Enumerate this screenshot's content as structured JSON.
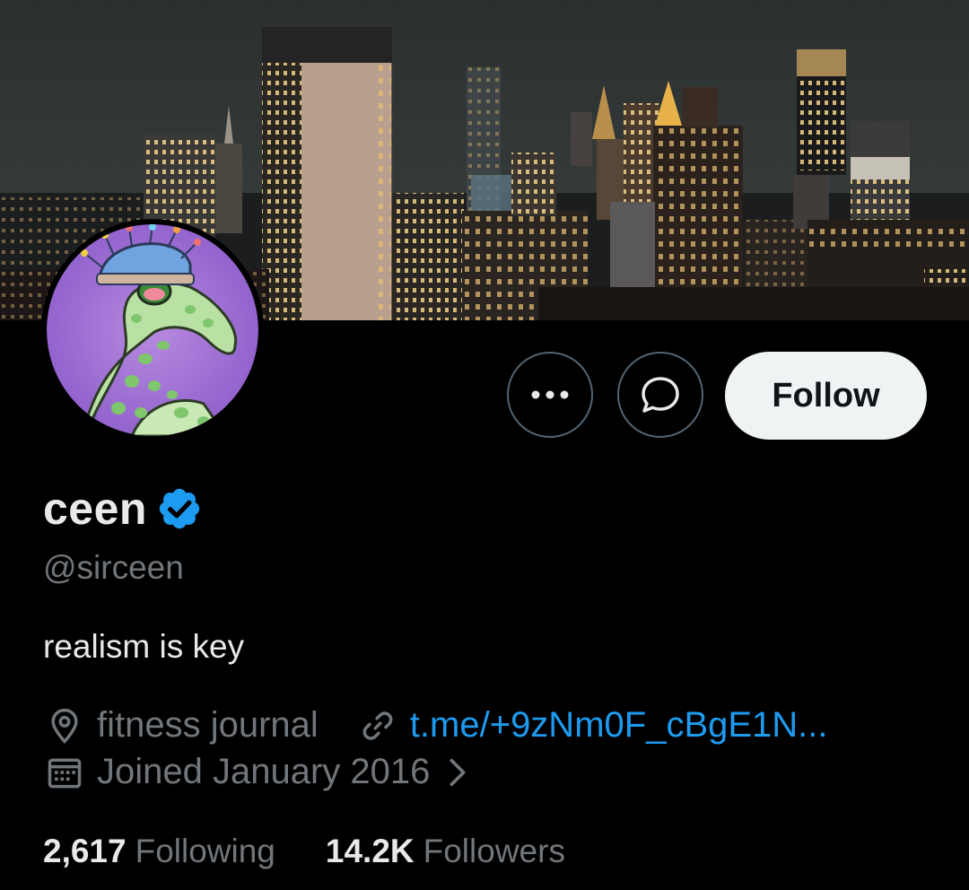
{
  "profile": {
    "display_name": "ceen",
    "handle": "@sirceen",
    "bio": "realism is key",
    "verified_icon": "verified-badge-icon",
    "verified_color": "#1d9bf0"
  },
  "actions": {
    "more_icon": "more-horizontal-icon",
    "message_icon": "message-bubble-icon",
    "follow_label": "Follow"
  },
  "meta": {
    "location_icon": "location-pin-icon",
    "location": "fitness journal",
    "link_icon": "link-icon",
    "link_text": "t.me/+9zNm0F_cBgE1N...",
    "calendar_icon": "calendar-icon",
    "joined": "Joined January 2016",
    "chevron_icon": "chevron-right-icon"
  },
  "stats": {
    "following_count": "2,617",
    "following_label": "Following",
    "followers_count": "14.2K",
    "followers_label": "Followers"
  },
  "colors": {
    "background": "#000000",
    "text_primary": "#e7e9ea",
    "text_secondary": "#71767b",
    "accent": "#1d9bf0",
    "follow_button_bg": "#eff3f4"
  }
}
